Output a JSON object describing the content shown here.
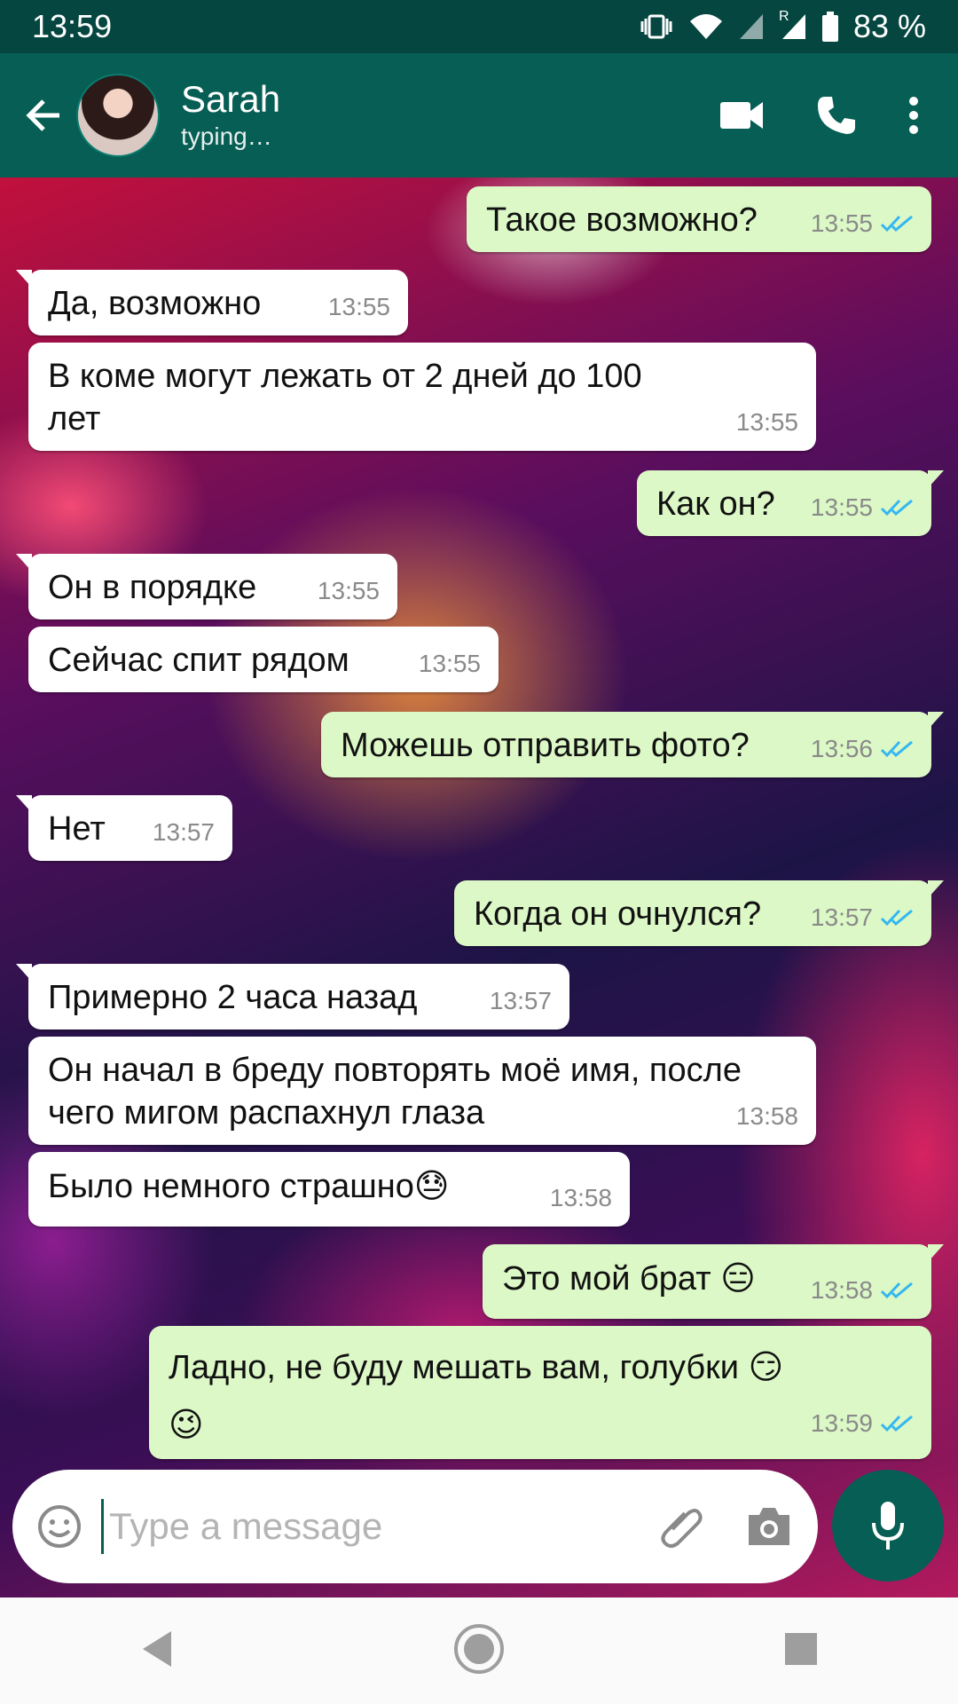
{
  "status_bar": {
    "time": "13:59",
    "roaming": "R",
    "battery": "83 %"
  },
  "header": {
    "contact_name": "Sarah",
    "contact_status": "typing…"
  },
  "messages": [
    {
      "text": "Такое возможно?",
      "time": "13:55"
    },
    {
      "text": "Да, возможно",
      "time": "13:55"
    },
    {
      "text": "В коме могут лежать от 2 дней до 100 лет",
      "time": "13:55"
    },
    {
      "text": "Как он?",
      "time": "13:55"
    },
    {
      "text": "Он в порядке",
      "time": "13:55"
    },
    {
      "text": "Сейчас спит рядом",
      "time": "13:55"
    },
    {
      "text": "Можешь отправить фото?",
      "time": "13:56"
    },
    {
      "text": "Нет",
      "time": "13:57"
    },
    {
      "text": "Когда он очнулся?",
      "time": "13:57"
    },
    {
      "text": "Примерно 2 часа назад",
      "time": "13:57"
    },
    {
      "text": "Он начал в бреду повторять моё имя, после чего мигом распахнул глаза",
      "time": "13:58"
    },
    {
      "text": "Было немного страшно",
      "emoji": "😓",
      "time": "13:58"
    },
    {
      "text": "Это мой брат",
      "emoji": "😑",
      "time": "13:58"
    },
    {
      "text": "Ладно, не буду мешать вам, голубки",
      "emoji": "😏",
      "emoji2": "😉",
      "time": "13:59"
    }
  ],
  "input": {
    "placeholder": "Type a message"
  },
  "colors": {
    "header": "#075e54",
    "status_bar": "#054640",
    "outgoing": "#dcf8c6",
    "incoming": "#ffffff",
    "ticks": "#34b7f1"
  },
  "icons": [
    "back-arrow-icon",
    "video-call-icon",
    "phone-icon",
    "more-vert-icon",
    "emoji-icon",
    "attach-icon",
    "camera-icon",
    "mic-icon",
    "nav-back-icon",
    "nav-home-icon",
    "nav-recents-icon"
  ]
}
